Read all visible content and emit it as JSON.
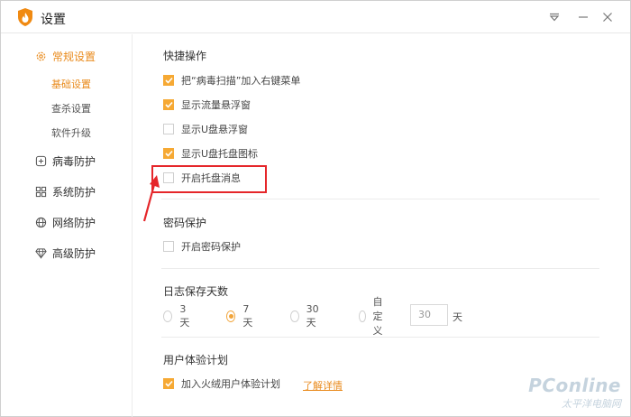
{
  "window": {
    "title": "设置"
  },
  "sidebar": {
    "items": [
      {
        "label": "常规设置",
        "icon": "gear-icon",
        "active": true
      },
      {
        "label": "病毒防护",
        "icon": "plus-square-icon"
      },
      {
        "label": "系统防护",
        "icon": "grid-icon"
      },
      {
        "label": "网络防护",
        "icon": "globe-icon"
      },
      {
        "label": "高级防护",
        "icon": "diamond-icon"
      }
    ],
    "subitems": [
      {
        "label": "基础设置",
        "active": true
      },
      {
        "label": "查杀设置"
      },
      {
        "label": "软件升级"
      }
    ]
  },
  "sections": {
    "shortcut": {
      "title": "快捷操作",
      "options": [
        {
          "label": "把“病毒扫描”加入右键菜单",
          "checked": true
        },
        {
          "label": "显示流量悬浮窗",
          "checked": true
        },
        {
          "label": "显示U盘悬浮窗",
          "checked": false
        },
        {
          "label": "显示U盘托盘图标",
          "checked": true
        },
        {
          "label": "开启托盘消息",
          "checked": false
        }
      ]
    },
    "password": {
      "title": "密码保护",
      "options": [
        {
          "label": "开启密码保护",
          "checked": false
        }
      ]
    },
    "log": {
      "title": "日志保存天数",
      "radios": [
        {
          "label": "3天",
          "checked": false
        },
        {
          "label": "7天",
          "checked": true
        },
        {
          "label": "30天",
          "checked": false
        },
        {
          "label": "自定义",
          "checked": false
        }
      ],
      "custom_value": "30",
      "unit": "天"
    },
    "experience": {
      "title": "用户体验计划",
      "options": [
        {
          "label": "加入火绒用户体验计划",
          "checked": true
        }
      ],
      "link": "了解详情"
    }
  },
  "watermark": {
    "main": "PConline",
    "sub": "太平洋电脑网"
  },
  "colors": {
    "accent": "#e98a1b",
    "checkbox": "#f6a934",
    "highlight": "#e5262a"
  }
}
